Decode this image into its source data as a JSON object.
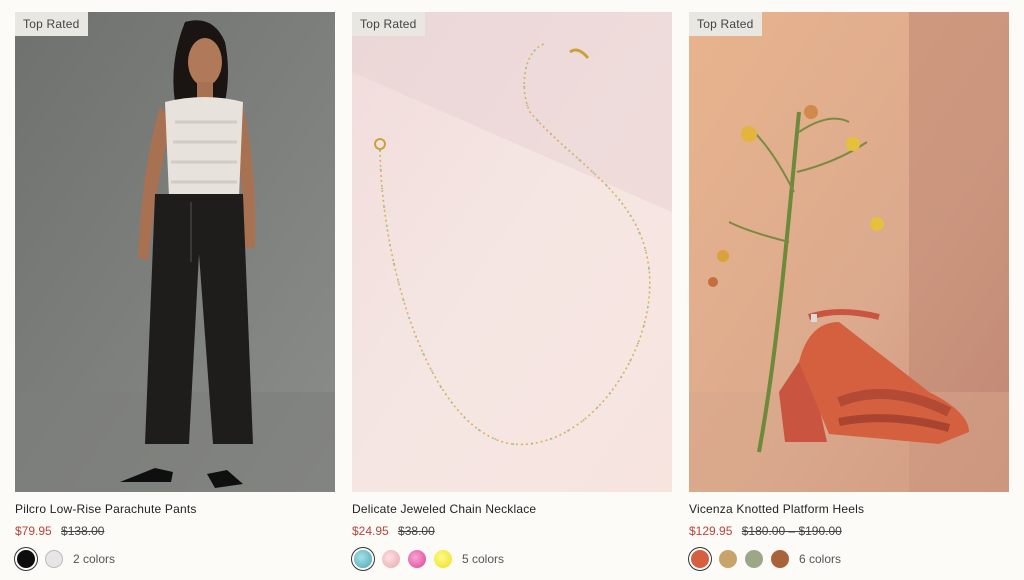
{
  "products": [
    {
      "badge": "Top Rated",
      "name": "Pilcro Low-Rise Parachute Pants",
      "sale_price": "$79.95",
      "original_price": "$138.00",
      "colors_label": "2 colors",
      "swatch_colors": [
        "#0d0d0d",
        "#e6e6e6"
      ],
      "image": "model-in-lace-top-and-black-pants"
    },
    {
      "badge": "Top Rated",
      "name": "Delicate Jeweled Chain Necklace",
      "sale_price": "$24.95",
      "original_price": "$38.00",
      "colors_label": "5 colors",
      "swatch_colors": [
        "#5fb8c4",
        "#f3c3c8",
        "#e85ea6",
        "#f3ec3c"
      ],
      "image": "gold-chain-necklace"
    },
    {
      "badge": "Top Rated",
      "name": "Vicenza Knotted Platform Heels",
      "sale_price": "$129.95",
      "original_price": "$180.00 – $190.00",
      "colors_label": "6 colors",
      "swatch_colors": [
        "#d4603f",
        "#c8a46a",
        "#9ea68a",
        "#a8633c"
      ],
      "image": "coral-knotted-platform-heel"
    }
  ]
}
